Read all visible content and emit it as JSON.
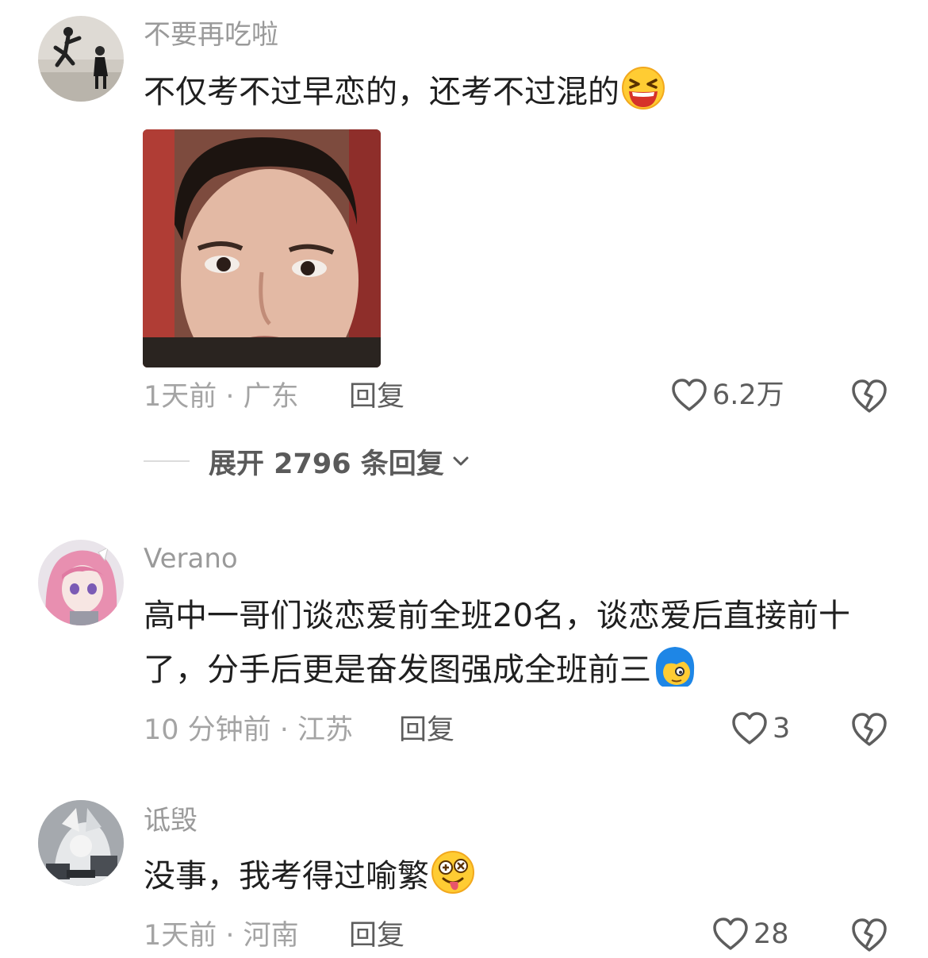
{
  "comments": [
    {
      "username": "不要再吃啦",
      "text": "不仅考不过早恋的，还考不过混的",
      "emoji": "laughing-emoji",
      "has_image": true,
      "time_location": "1天前 · 广东",
      "reply_label": "回复",
      "likes": "6.2万",
      "expand_label": "展开 2796 条回复"
    },
    {
      "username": "Verano",
      "text": "高中一哥们谈恋爱前全班20名，谈恋爱后直接前十了，分手后更是奋发图强成全班前三",
      "emoji": "blue-hair-emoji",
      "time_location": "10 分钟前 · 江苏",
      "reply_label": "回复",
      "likes": "3"
    },
    {
      "username": "诋毁",
      "text": "没事，我考得过喻繁",
      "emoji": "silly-tongue-emoji",
      "time_location": "1天前 · 河南",
      "reply_label": "回复",
      "likes": "28"
    }
  ],
  "colors": {
    "username": "#9a9a9a",
    "meta": "#a4a4a4",
    "action": "#5d5d5d",
    "text": "#1f1f1f"
  },
  "icons": [
    "heart-icon",
    "broken-heart-icon",
    "chevron-down-icon"
  ]
}
